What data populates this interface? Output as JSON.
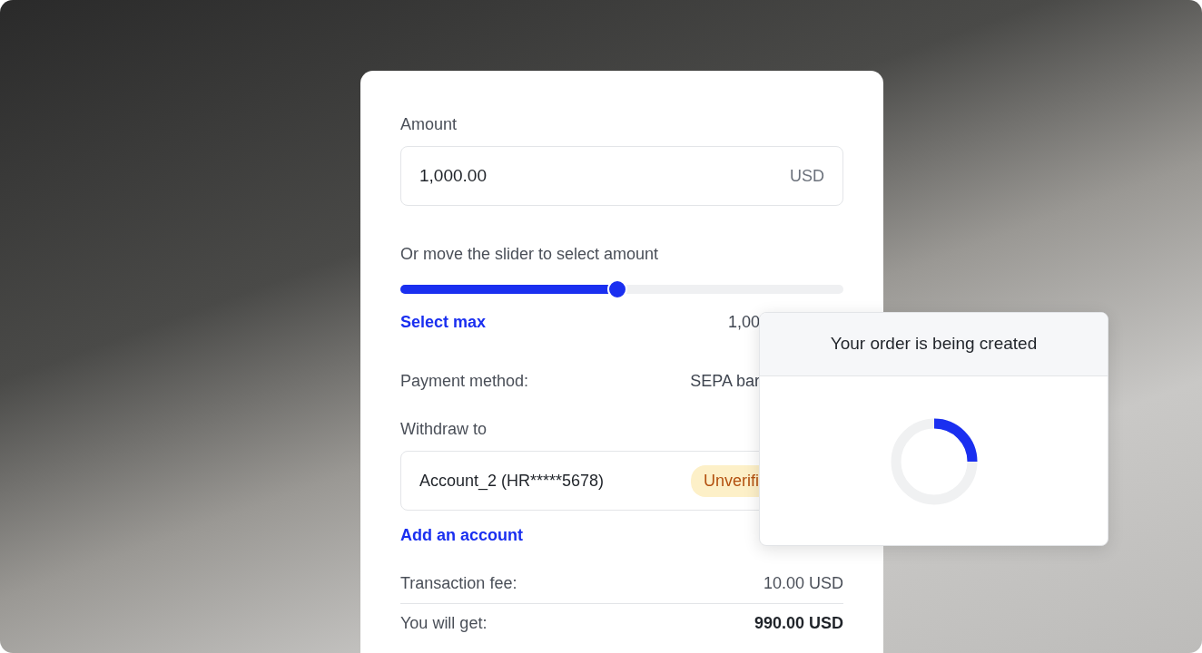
{
  "form": {
    "amount_label": "Amount",
    "amount_value": "1,000.00",
    "currency": "USD",
    "slider_label": "Or move the slider to select amount",
    "slider": {
      "level": 0.49
    },
    "select_max": "Select max",
    "max_value": "1,00",
    "payment_method_label": "Payment method:",
    "payment_method_value": "SEPA bar",
    "withdraw_label": "Withdraw to",
    "account": "Account_2 (HR*****5678)",
    "account_status": "Unverifi",
    "add_account": "Add an account",
    "summary": [
      {
        "label": "Transaction fee:",
        "value": "10.00 USD",
        "emphasis": false
      },
      {
        "label": "You will get:",
        "value": "990.00 USD",
        "emphasis": true
      }
    ]
  },
  "dialog": {
    "title": "Your order is being created"
  }
}
